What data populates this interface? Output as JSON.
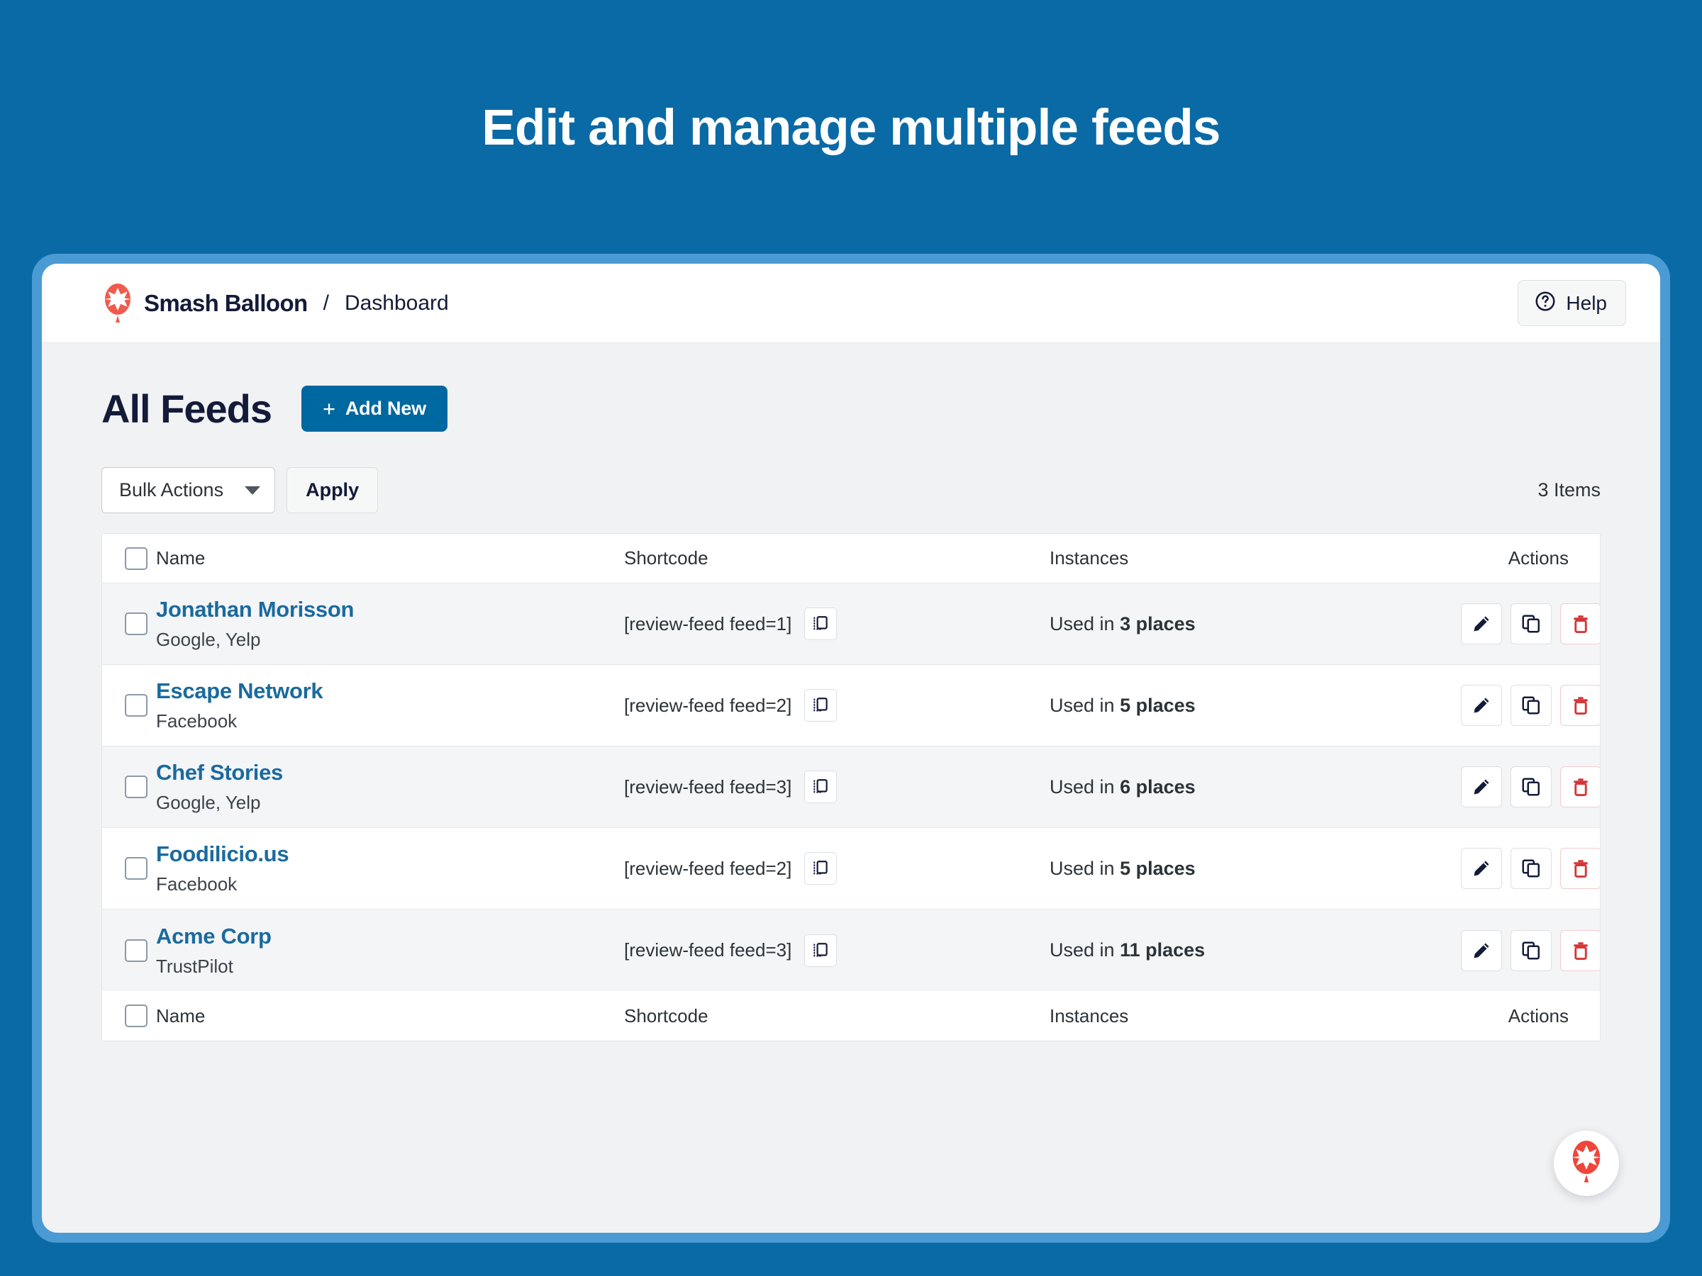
{
  "hero": {
    "headline": "Edit and manage multiple feeds",
    "background_color": "#0a6aa5",
    "frame_border_color": "#4a9bd4"
  },
  "topbar": {
    "brand_name": "Smash Balloon",
    "breadcrumb_separator": "/",
    "breadcrumb_current": "Dashboard",
    "logo_icon": "smash-balloon-logo-icon",
    "help": {
      "label": "Help",
      "icon": "question-circle-icon"
    }
  },
  "page": {
    "title": "All Feeds",
    "add_new": {
      "label": "Add New",
      "plus": "+",
      "color": "#0068a0"
    }
  },
  "toolbar": {
    "bulk_actions_label": "Bulk Actions",
    "bulk_actions_caret_icon": "chevron-down-icon",
    "apply_label": "Apply",
    "items_count": "3 Items"
  },
  "table": {
    "columns": {
      "name": "Name",
      "shortcode": "Shortcode",
      "instances": "Instances",
      "actions": "Actions"
    },
    "link_color": "#1a6a9e",
    "delete_color": "#d63638",
    "row_actions": {
      "edit_icon": "pencil-edit-icon",
      "duplicate_icon": "duplicate-copy-icon",
      "delete_icon": "trash-delete-icon",
      "copy_shortcode_icon": "copy-shortcode-icon"
    },
    "rows": [
      {
        "name": "Jonathan Morisson",
        "sources": "Google, Yelp",
        "shortcode": "[review-feed feed=1]",
        "instances_prefix": "Used in ",
        "instances_value": "3 places",
        "shaded": true
      },
      {
        "name": "Escape Network",
        "sources": "Facebook",
        "shortcode": "[review-feed feed=2]",
        "instances_prefix": "Used in ",
        "instances_value": "5 places",
        "shaded": false
      },
      {
        "name": "Chef Stories",
        "sources": "Google, Yelp",
        "shortcode": "[review-feed feed=3]",
        "instances_prefix": "Used in ",
        "instances_value": "6 places",
        "shaded": true
      },
      {
        "name": "Foodilicio.us",
        "sources": "Facebook",
        "shortcode": "[review-feed feed=2]",
        "instances_prefix": "Used in ",
        "instances_value": "5 places",
        "shaded": false
      },
      {
        "name": "Acme Corp",
        "sources": "TrustPilot",
        "shortcode": "[review-feed feed=3]",
        "instances_prefix": "Used in ",
        "instances_value": "11 places",
        "shaded": true
      }
    ]
  },
  "fab": {
    "icon": "smash-balloon-logo-icon"
  }
}
